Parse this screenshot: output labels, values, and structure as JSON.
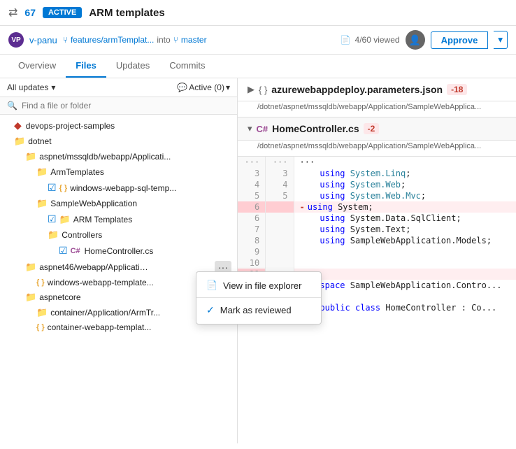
{
  "topbar": {
    "pr_icon": "⇄",
    "pr_number": "67",
    "active_badge": "ACTIVE",
    "pr_title": "ARM templates"
  },
  "userbar": {
    "avatar_initials": "VP",
    "username": "v-panu",
    "branch_from": "features/armTemplat...",
    "branch_into": "into",
    "branch_to": "master",
    "viewed": "4/60 viewed",
    "approve_label": "Approve"
  },
  "nav_tabs": [
    {
      "label": "Overview",
      "active": false
    },
    {
      "label": "Files",
      "active": true
    },
    {
      "label": "Updates",
      "active": false
    },
    {
      "label": "Commits",
      "active": false
    }
  ],
  "filter_bar": {
    "all_updates": "All updates",
    "active_filter": "Active (0)"
  },
  "search": {
    "placeholder": "Find a file or folder"
  },
  "file_tree": [
    {
      "id": "root",
      "indent": 0,
      "icon": "root",
      "name": "devops-project-samples",
      "type": "root"
    },
    {
      "id": "dotnet",
      "indent": 1,
      "icon": "folder",
      "name": "dotnet",
      "type": "folder"
    },
    {
      "id": "aspnet-mssql",
      "indent": 2,
      "icon": "folder",
      "name": "aspnet/mssqldb/webapp/Applicati...",
      "type": "folder"
    },
    {
      "id": "armtemplates",
      "indent": 3,
      "icon": "folder",
      "name": "ArmTemplates",
      "type": "folder"
    },
    {
      "id": "windows-webapp-sql",
      "indent": 4,
      "icon": "json",
      "name": "windows-webapp-sql-temp...",
      "type": "file",
      "checked": true
    },
    {
      "id": "samplewebapp",
      "indent": 3,
      "icon": "folder",
      "name": "SampleWebApplication",
      "type": "folder"
    },
    {
      "id": "arm-templates",
      "indent": 4,
      "icon": "folder",
      "name": "ARM Templates",
      "type": "folder",
      "checked": true
    },
    {
      "id": "controllers",
      "indent": 4,
      "icon": "folder",
      "name": "Controllers",
      "type": "folder"
    },
    {
      "id": "homecontroller",
      "indent": 5,
      "icon": "csharp",
      "name": "HomeController.cs",
      "type": "file",
      "checked": true
    },
    {
      "id": "aspnet46",
      "indent": 2,
      "icon": "folder",
      "name": "aspnet46/webapp/Applicatio...",
      "type": "folder",
      "has_dots": true
    },
    {
      "id": "windows-webapp-template",
      "indent": 3,
      "icon": "json",
      "name": "windows-webapp-template...",
      "type": "file"
    },
    {
      "id": "aspnetcore",
      "indent": 2,
      "icon": "folder",
      "name": "aspnetcore",
      "type": "folder"
    },
    {
      "id": "container-app-arm",
      "indent": 3,
      "icon": "folder",
      "name": "container/Application/ArmTr...",
      "type": "folder"
    },
    {
      "id": "container-webapp",
      "indent": 3,
      "icon": "json",
      "name": "container-webapp-templat...",
      "type": "file"
    }
  ],
  "context_menu": {
    "items": [
      {
        "icon": "file-explorer-icon",
        "label": "View in file explorer",
        "checked": false
      },
      {
        "icon": "check-icon",
        "label": "Mark as reviewed",
        "checked": true
      }
    ]
  },
  "right_panel": {
    "files": [
      {
        "name": "azurewebappdeploy.parameters.json",
        "diff": "-18",
        "path": "/dotnet/aspnet/mssqldb/webapp/Application/SampleWebApplica...",
        "collapsed": true,
        "section": "{ }"
      },
      {
        "name": "HomeController.cs",
        "diff": "-2",
        "path": "/dotnet/aspnet/mssqldb/webapp/Application/SampleWebApplica...",
        "section": "C#",
        "lines": [
          {
            "old": "...",
            "new": "...",
            "code": "..."
          },
          {
            "old": "3",
            "new": "3",
            "code": "using System.Linq;"
          },
          {
            "old": "4",
            "new": "4",
            "code": "using System.Web;"
          },
          {
            "old": "5",
            "new": "5",
            "code": "using System.Web.Mvc;"
          },
          {
            "old": "6",
            "new": "",
            "code": "using System;",
            "removed": true
          },
          {
            "old": "6",
            "new": "",
            "code": "using System.Data.SqlClient;"
          },
          {
            "old": "7",
            "new": "",
            "code": "using System.Text;"
          },
          {
            "old": "8",
            "new": "",
            "code": "using SampleWebApplication.Models;"
          },
          {
            "old": "9",
            "new": "",
            "code": ""
          },
          {
            "old": "10",
            "new": "",
            "code": ""
          },
          {
            "old": "11",
            "new": "",
            "code": "",
            "removed_line": true
          },
          {
            "old": "",
            "new": "",
            "code": "namespace SampleWebApplication.Contro..."
          },
          {
            "old": "",
            "new": "",
            "code": "{"
          },
          {
            "old": "",
            "new": "",
            "code": "    public class HomeController : Co..."
          }
        ]
      }
    ]
  }
}
